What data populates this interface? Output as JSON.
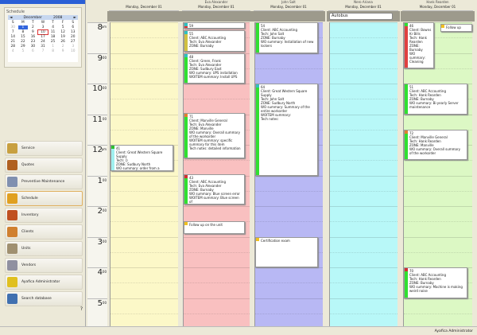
{
  "sidebar": {
    "schedule_title": "Schedule",
    "calendar": {
      "month": "December",
      "year": "2008",
      "prev": "◄",
      "next": "►",
      "weekdays": [
        "S",
        "M",
        "T",
        "W",
        "T",
        "F",
        "S"
      ],
      "days": [
        "30",
        "1",
        "2",
        "3",
        "4",
        "5",
        "6",
        "7",
        "8",
        "9",
        "10",
        "11",
        "12",
        "13",
        "14",
        "15",
        "16",
        "17",
        "18",
        "19",
        "20",
        "21",
        "22",
        "23",
        "24",
        "25",
        "26",
        "27",
        "28",
        "29",
        "30",
        "31",
        "1",
        "2",
        "3",
        "4",
        "5",
        "6",
        "7",
        "8",
        "9",
        "10"
      ],
      "selected": "1",
      "today": "10"
    },
    "nav": [
      {
        "label": "Service",
        "icon": "service-icon",
        "color": "#c8a040"
      },
      {
        "label": "Quotes",
        "icon": "quotes-icon",
        "color": "#b06020"
      },
      {
        "label": "Preventive Maintenance",
        "icon": "maintenance-icon",
        "color": "#8090b0"
      },
      {
        "label": "Schedule",
        "icon": "schedule-icon",
        "color": "#e0a020"
      },
      {
        "label": "Inventory",
        "icon": "inventory-icon",
        "color": "#c05020"
      },
      {
        "label": "Clients",
        "icon": "clients-icon",
        "color": "#d08030"
      },
      {
        "label": "Units",
        "icon": "units-icon",
        "color": "#a09070"
      },
      {
        "label": "Vendors",
        "icon": "vendors-icon",
        "color": "#9090a0"
      },
      {
        "label": "Ayafica Administrator",
        "icon": "administrator-icon",
        "color": "#e0c020"
      },
      {
        "label": "Search database",
        "icon": "search-icon",
        "color": "#4070b0"
      }
    ],
    "active": "Schedule",
    "footer_icons": [
      "help-icon"
    ],
    "footer_help": "?"
  },
  "hours": [
    {
      "label": "8",
      "ampm": "am"
    },
    {
      "label": "9",
      "ampm": "00"
    },
    {
      "label": "10",
      "ampm": "00"
    },
    {
      "label": "11",
      "ampm": "00"
    },
    {
      "label": "12",
      "ampm": "pm"
    },
    {
      "label": "1",
      "ampm": "00"
    },
    {
      "label": "2",
      "ampm": "00"
    },
    {
      "label": "3",
      "ampm": "00"
    },
    {
      "label": "4",
      "ampm": "00"
    },
    {
      "label": "5",
      "ampm": "00"
    }
  ],
  "columns": [
    {
      "name": "",
      "date": "Monday, December 01",
      "bg": "#fcf8c8",
      "appts": [
        {
          "start": 12.0,
          "end": 12.85,
          "bar": "#a0f0f0",
          "tag": "#30c030",
          "text": "41\nClient: Great Western Square\nSupply\nTech: ()\nZONE: Sudbury North\nWO summary: order from a"
        }
      ]
    },
    {
      "name": "Eva Alexander",
      "date": "Monday, December 01",
      "bg": "#f9c0c0",
      "appts": [
        {
          "start": 8.0,
          "end": 8.2,
          "bar": "#e03030",
          "tag": "#30c0c0",
          "text": "59"
        },
        {
          "start": 8.25,
          "end": 8.95,
          "bar": "#d0c040",
          "tag": "#30c0c0",
          "text": "55\nClient: ABC Accounting\nTech: Eva Alexander\nZONE: Burnaby"
        },
        {
          "start": 9.0,
          "end": 10.0,
          "bar": "#30e030",
          "tag": "#30c0c0",
          "text": "48\nClient: Green, Frank\nTech: Eva Alexander\nZONE: Sudbury East\nWO summary: UPS installation\nWOITEM summary: Install UPS"
        },
        {
          "start": 10.95,
          "end": 12.45,
          "bar": "#30e030",
          "tag": "#e08030",
          "text": "71\nClient: Manville General\nTech: Eva Alexander\nZONE: Manville\nWO summary: Overall summary\nof the workorder\nWOITEM summary: specific\nsummary for this item\nTech notes: detailed information"
        },
        {
          "start": 12.95,
          "end": 13.95,
          "bar": "#30e030",
          "tag": "#d03030",
          "text": "43\nClient: ABC Accounting\nTech: Eva Alexander\nZONE: Burnaby\nWO summary: Blue screen error\nWOITEM summary: Blue screen of"
        },
        {
          "start": 14.5,
          "end": 14.9,
          "bar": "#ffffff",
          "tag": "#f0c020",
          "text": "Follow up on the unit"
        }
      ]
    },
    {
      "name": "John Salt",
      "date": "Monday, December 01",
      "bg": "#b8b8f4",
      "appts": [
        {
          "start": 8.0,
          "end": 9.0,
          "bar": "#30e030",
          "tag": "#30e030",
          "text": "54\nClient: ABC Accounting\nTech: John Salt\nZONE: Burnaby\nWO summary: Installation of new\nlockers"
        },
        {
          "start": 10.0,
          "end": 13.0,
          "bar": "#30e030",
          "tag": "#30c0c0",
          "text": "64\nClient: Great Western Square\nSupply\nTech: John Salt\nZONE: Sudbury North\nWO summary: Summary of the\nentire workorder\nWOITEM summary:\nTech notes:"
        },
        {
          "start": 15.0,
          "end": 16.0,
          "bar": "#ffffff",
          "tag": "#f0c020",
          "text": "Certification exam"
        }
      ]
    },
    {
      "name": "Nero Ariana",
      "date": "Monday, December 01",
      "bg": "#b8f8f8",
      "input": "Autobus",
      "appts": []
    },
    {
      "name": "Hank Rearden",
      "date": "Monday, December 01",
      "bg": "#dcf8c4",
      "appts": [
        {
          "start": 8.0,
          "end": 9.5,
          "bar": "#e04040",
          "tag": "#30e030",
          "narrow": true,
          "text": "46\nClient: Bowns\nKr Bills\nTech: Hank\nRearden\nZONE:\nBurnaby\nWO summary:\nCleaning"
        },
        {
          "start": 8.05,
          "end": 8.3,
          "bar": "#ffffff",
          "tag": "#f0c020",
          "right": true,
          "text": "Follow up"
        },
        {
          "start": 10.0,
          "end": 11.0,
          "bar": "#30e030",
          "tag": "#30e030",
          "text": "51\nClient: ABC Accounting\nTech: Hank Rearden\nZONE: Burnaby\nWO summary: Bi-yearly Server\nmaintenance"
        },
        {
          "start": 11.5,
          "end": 12.5,
          "bar": "#30e030",
          "tag": "#e08030",
          "text": "72\nClient: Manville General\nTech: Hank Rearden\nZONE: Manville\nWO summary: Overall summary\nof the workorder"
        },
        {
          "start": 16.0,
          "end": 17.0,
          "bar": "#30e030",
          "tag": "#d03030",
          "text": "70\nClient: ABC Accounting\nTech: Hank Rearden\nZONE: Burnaby\nWO summary: Machine is making\nweird noise"
        }
      ]
    }
  ],
  "status": "Ayafica Administrator"
}
